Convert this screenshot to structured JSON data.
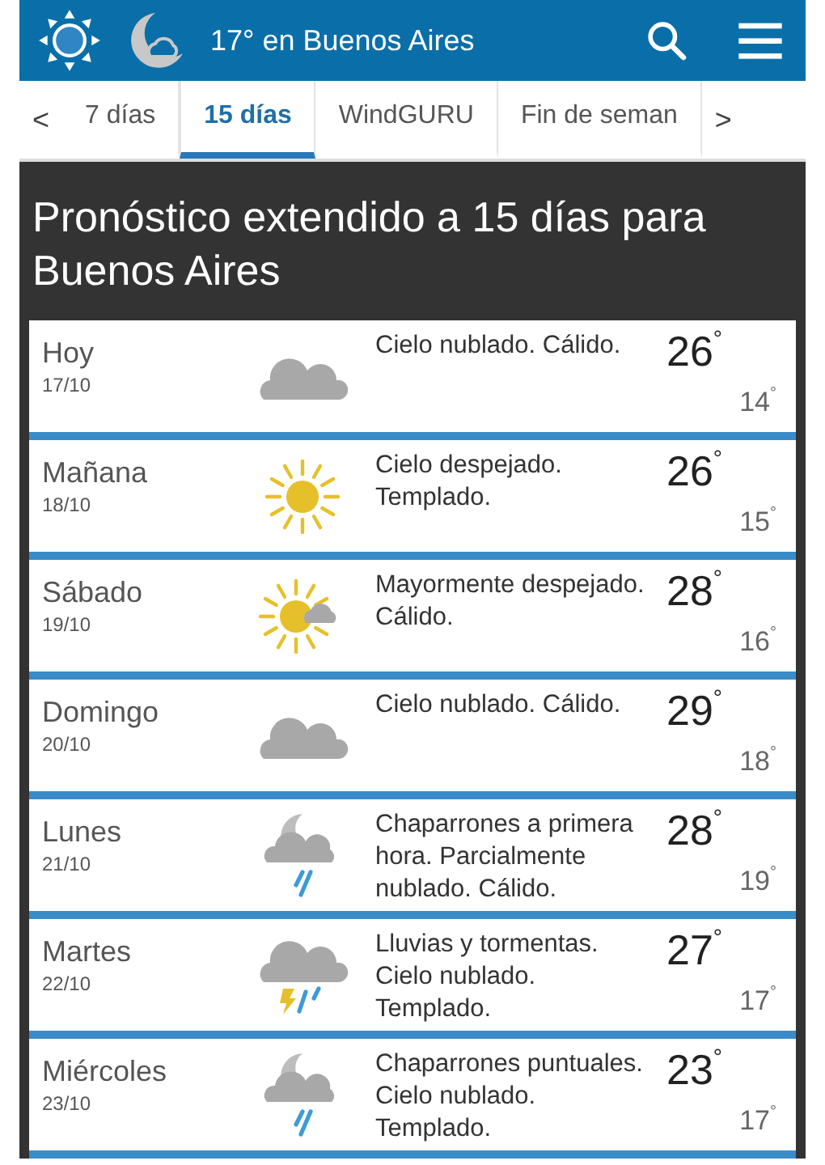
{
  "header": {
    "title": "17° en Buenos Aires"
  },
  "tabs": {
    "prev": "<",
    "next": ">",
    "items": [
      {
        "label": "7 días",
        "selected": false
      },
      {
        "label": "15 días",
        "selected": true
      },
      {
        "label": "WindGURU",
        "selected": false
      },
      {
        "label": "Fin de seman",
        "selected": false
      }
    ]
  },
  "heading": "Pronóstico extendido a 15 días para Buenos Aires",
  "days": [
    {
      "day": "Hoy",
      "date": "17/10",
      "kind": "cloud",
      "description": "Cielo nublado. Cálido.",
      "max": "26$^{°}$",
      "min": "14$^{°}$"
    },
    {
      "day": "Mañana",
      "date": "18/10",
      "kind": "sun",
      "description": "Cielo despejado. Templado.",
      "max": "26$^{°}$",
      "min": "15$^{°}$"
    },
    {
      "day": "Sábado",
      "date": "19/10",
      "kind": "sun-cloud",
      "description": "Mayormente despejado. Cálido.",
      "max": "28$^{°}$",
      "min": "16$^{°}$"
    },
    {
      "day": "Domingo",
      "date": "20/10",
      "kind": "cloud",
      "description": "Cielo nublado. Cálido.",
      "max": "29$^{°}$",
      "min": "18$^{°}$"
    },
    {
      "day": "Lunes",
      "date": "21/10",
      "kind": "moon-rain",
      "description": "Chaparrones a primera hora. Parcialmente nublado. Cálido.",
      "max": "28$^{°}$",
      "min": "19$^{°}$"
    },
    {
      "day": "Martes",
      "date": "22/10",
      "kind": "storm",
      "description": "Lluvias y tormentas. Cielo nublado. Templado.",
      "max": "27$^{°}$",
      "min": "17$^{°}$"
    },
    {
      "day": "Miércoles",
      "date": "23/10",
      "kind": "moon-rain",
      "description": "Chaparrones puntuales. Cielo nublado. Templado.",
      "max": "23$^{°}$",
      "min": "17$^{°}$"
    }
  ]
}
